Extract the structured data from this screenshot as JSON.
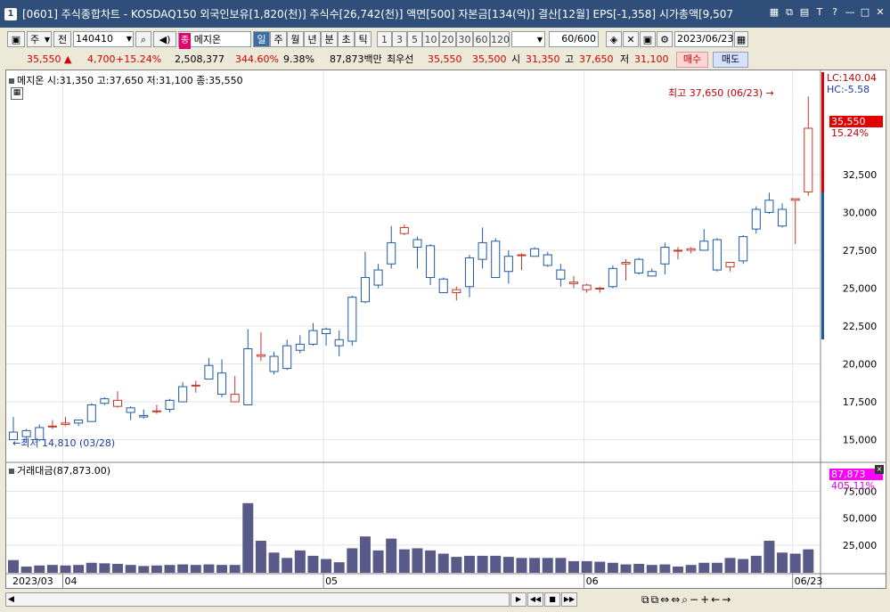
{
  "window": {
    "index": "1",
    "title": "[0601] 주식종합차트 - KOSDAQ150 외국인보유[1,820(천)] 주식수[26,742(천)] 액면[500] 자본금[134(억)] 결산[12월] EPS[-1,358] 시가총액[9,507"
  },
  "toolbar": {
    "period": "주",
    "prev": "전",
    "code": "140410",
    "search": "Q",
    "sound": "◀)",
    "name": "메지온",
    "name_badge": "종",
    "tabs": [
      "일",
      "주",
      "월",
      "년",
      "분",
      "초",
      "틱"
    ],
    "intervals": [
      "1",
      "3",
      "5",
      "10",
      "20",
      "30",
      "60",
      "120"
    ],
    "count": "60",
    "count_max": "/600",
    "date": "2023/06/23"
  },
  "pricebar": {
    "price": "35,550",
    "change": "4,700",
    "change_pct": "+15.24%",
    "volume": "2,508,377",
    "vol_ratio": "344.60%",
    "turnover": "9.38%",
    "amount": "87,873백만",
    "best_label": "최우선",
    "ask": "35,550",
    "bid": "35,500",
    "open_label": "시",
    "open": "31,350",
    "high_label": "고",
    "high": "37,650",
    "low_label": "저",
    "low": "31,100",
    "buy": "매수",
    "sell": "매도"
  },
  "chart_data": {
    "type": "candlestick",
    "legend": "메지온 시:31,350 고:37,650 저:31,100 종:35,550",
    "annot_high": "최고 37,650 (06/23)",
    "annot_low": "최저 14,810 (03/28)",
    "lc": "LC:140.04",
    "hc": "HC:-5.58",
    "last_price": "35,550",
    "last_pct": "15.24%",
    "ylim": [
      13800,
      38900
    ],
    "yticks": [
      "15,000",
      "17,500",
      "20,000",
      "22,500",
      "25,000",
      "27,500",
      "30,000",
      "32,500"
    ],
    "ytick_values": [
      15000,
      17500,
      20000,
      22500,
      25000,
      27500,
      30000,
      32500
    ],
    "xlabels": [
      "2023/03",
      "04",
      "05",
      "06",
      "06/23"
    ],
    "xlabel_idx": [
      0,
      4,
      24,
      44,
      60
    ],
    "candles": [
      [
        15500,
        16500,
        15000,
        15000
      ],
      [
        15600,
        15700,
        14810,
        15200
      ],
      [
        15800,
        16000,
        14900,
        15000
      ],
      [
        15900,
        16300,
        15700,
        15900
      ],
      [
        16000,
        16500,
        15900,
        16100
      ],
      [
        16300,
        16300,
        15900,
        16100
      ],
      [
        17300,
        17400,
        16200,
        16200
      ],
      [
        17700,
        17800,
        17300,
        17400
      ],
      [
        17200,
        18200,
        17100,
        17600
      ],
      [
        17100,
        17200,
        16300,
        16800
      ],
      [
        16600,
        17000,
        16400,
        16500
      ],
      [
        16900,
        17300,
        16700,
        16900
      ],
      [
        17600,
        17700,
        16800,
        17000
      ],
      [
        18500,
        18800,
        17500,
        17500
      ],
      [
        18600,
        18900,
        18100,
        18600
      ],
      [
        19900,
        20400,
        19000,
        19000
      ],
      [
        19400,
        20300,
        17800,
        18000
      ],
      [
        17500,
        19200,
        17500,
        18000
      ],
      [
        21000,
        22300,
        17300,
        17300
      ],
      [
        20500,
        22100,
        20200,
        20600
      ],
      [
        20500,
        20800,
        19300,
        19500
      ],
      [
        21200,
        21600,
        19600,
        19700
      ],
      [
        21300,
        21900,
        20700,
        20900
      ],
      [
        22200,
        22700,
        21200,
        21300
      ],
      [
        22300,
        22400,
        21200,
        22000
      ],
      [
        21600,
        22200,
        20500,
        21200
      ],
      [
        24400,
        24500,
        21200,
        21500
      ],
      [
        25700,
        27400,
        24000,
        24100
      ],
      [
        26200,
        26600,
        25000,
        25200
      ],
      [
        28000,
        29100,
        26300,
        26600
      ],
      [
        28600,
        29200,
        28500,
        29000
      ],
      [
        28200,
        28400,
        26300,
        27700
      ],
      [
        27800,
        27900,
        25200,
        25700
      ],
      [
        25600,
        25700,
        24700,
        24700
      ],
      [
        24700,
        25100,
        24200,
        24900
      ],
      [
        27000,
        27200,
        24400,
        25100
      ],
      [
        28000,
        29000,
        26300,
        26900
      ],
      [
        28100,
        28300,
        25800,
        25700
      ],
      [
        27100,
        27500,
        25300,
        26100
      ],
      [
        27200,
        27300,
        26200,
        27200
      ],
      [
        27600,
        27700,
        27100,
        27100
      ],
      [
        27200,
        27400,
        26400,
        26500
      ],
      [
        26200,
        26600,
        25100,
        25600
      ],
      [
        25300,
        25800,
        25000,
        25400
      ],
      [
        24900,
        25300,
        24700,
        25200
      ],
      [
        25000,
        25100,
        24700,
        25000
      ],
      [
        26300,
        26500,
        25000,
        25100
      ],
      [
        26600,
        26900,
        25500,
        26700
      ],
      [
        26900,
        27000,
        25900,
        26000
      ],
      [
        26100,
        26300,
        25800,
        25800
      ],
      [
        27700,
        28000,
        25900,
        26600
      ],
      [
        27500,
        27700,
        26900,
        27500
      ],
      [
        27500,
        27700,
        27300,
        27600
      ],
      [
        28100,
        28900,
        27900,
        27500
      ],
      [
        28200,
        28300,
        26100,
        26200
      ],
      [
        26400,
        26700,
        26100,
        26700
      ],
      [
        28400,
        28500,
        26600,
        26800
      ],
      [
        30200,
        30400,
        28600,
        28900
      ],
      [
        30800,
        31300,
        29900,
        30000
      ],
      [
        30200,
        30600,
        29000,
        29100
      ],
      [
        30800,
        30900,
        27900,
        30900
      ],
      [
        31350,
        37650,
        31100,
        35550
      ]
    ],
    "vol_legend": "거래대금(87,873.00)",
    "vol_last": "87,873",
    "vol_pct": "405.11%",
    "vol_ylim": [
      0,
      92000
    ],
    "vol_yticks": [
      "25,000",
      "50,000",
      "75,000"
    ],
    "vol_ytick_values": [
      25000,
      50000,
      75000
    ],
    "volumes": [
      11000,
      5000,
      6000,
      6500,
      6000,
      6500,
      8500,
      8000,
      7500,
      6500,
      5500,
      6000,
      6500,
      7000,
      6500,
      7000,
      6500,
      6500,
      64000,
      29000,
      18000,
      13000,
      20000,
      15000,
      12000,
      9000,
      22000,
      33000,
      20000,
      31000,
      21000,
      22000,
      20000,
      17000,
      14000,
      15000,
      15000,
      15000,
      14000,
      13000,
      13000,
      13000,
      13000,
      10000,
      10000,
      9500,
      8500,
      7000,
      7500,
      6500,
      7000,
      5000,
      6500,
      8500,
      8500,
      13000,
      12000,
      15000,
      29000,
      18000,
      17000,
      21000,
      85000
    ]
  },
  "bottombar": {
    "buttons": [
      "▶",
      "◀◀",
      "■",
      "▶▶"
    ],
    "zoom": [
      "−",
      "+",
      "⇔",
      "Q",
      "−",
      "+",
      "←",
      "→"
    ]
  },
  "colors": {
    "up": "#c0392b",
    "down": "#1f5aa6",
    "vol": "#5a5a8a",
    "accent": "#e5004f"
  }
}
